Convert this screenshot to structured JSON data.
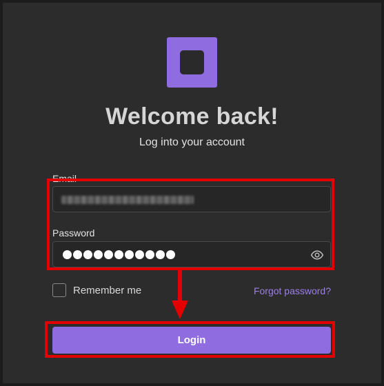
{
  "header": {
    "title": "Welcome back!",
    "subtitle": "Log into your account",
    "logo_icon": "square-logo-icon"
  },
  "form": {
    "email": {
      "label": "Email",
      "value": "[redacted email]"
    },
    "password": {
      "label": "Password",
      "masked_length": 11,
      "visibility_icon": "eye-icon"
    },
    "remember_me": {
      "label": "Remember me",
      "checked": false
    },
    "forgot_password": "Forgot password?",
    "login_button": "Login"
  },
  "colors": {
    "background": "#2c2c2c",
    "accent": "#8f6cdf",
    "link": "#9e7fe6",
    "annotation": "#e40000"
  }
}
